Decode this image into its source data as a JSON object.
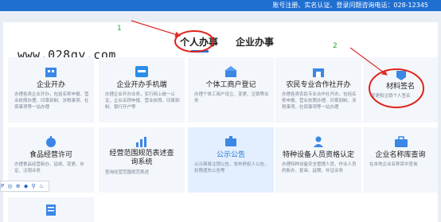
{
  "topbar": {
    "text": "账号注册、实名认证、登录问题咨询电话：028-12345"
  },
  "tabs": [
    {
      "label": "个人办事"
    },
    {
      "label": "企业办事"
    }
  ],
  "watermark": "www.028qy.com",
  "annotations": {
    "one": "1",
    "two": "2"
  },
  "cards": [
    {
      "title": "企业开办",
      "desc": "办理各类企业开办，包括名称申报、营业执照办理、印章刻制、涉税事项、社保事项等一站办理"
    },
    {
      "title": "企业开办手机端",
      "desc": "办理企业开办业务，实行网上统一认证，企业名称申报、营业执照、印章刻制、银行开户等"
    },
    {
      "title": "个体工商户登记",
      "desc": "办理个体工商户设立、变更、注销等业务"
    },
    {
      "title": "农民专业合作社开办",
      "desc": "办理各类农民专业合作社开办，包括名称申报、营业执照办理、印章刻制、涉税事项、社保事项等一站办理"
    },
    {
      "title": "材料签名",
      "desc": "变更和注销个人签名"
    },
    {
      "title": "食品经营许可",
      "desc": "办理食品经营新办、延续、变更、补证、注销业务"
    },
    {
      "title": "经营范围规范表述查询系统",
      "desc": "查询经营范围规范表述"
    },
    {
      "title": "公示公告",
      "desc": "公示简易注销公告，发布债权人公告，执照遗失公告等"
    },
    {
      "title": "特种设备人员资格认定",
      "desc": "办理特种设备安全管理人员、作业人员的新办、复审、延期、补证业务"
    },
    {
      "title": "企业名称库查询",
      "desc": "在本地企业名称库中查询"
    }
  ],
  "toolbar": {
    "icons": "P ◎ ⊕ ◆ ⚲ ♨"
  }
}
